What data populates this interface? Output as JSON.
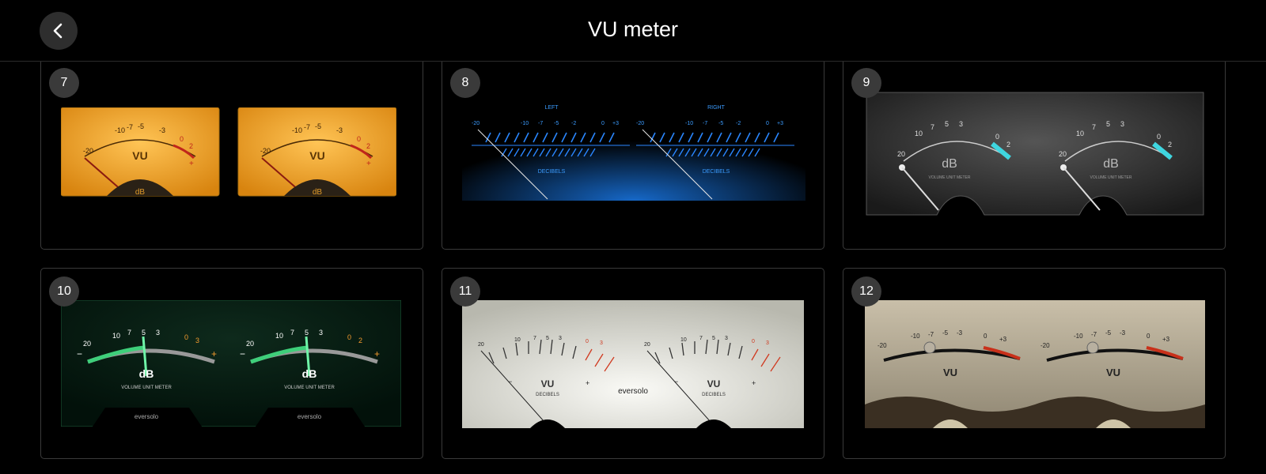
{
  "header": {
    "title": "VU meter"
  },
  "cards": [
    {
      "number": "7",
      "scale": [
        "-20",
        "-10",
        "-7",
        "-5",
        "-3",
        "0",
        "2",
        "+"
      ],
      "label": "VU",
      "sub": "dB"
    },
    {
      "number": "8",
      "left": "LEFT",
      "right": "RIGHT",
      "scale": [
        "-20",
        "-10",
        "-7",
        "-5",
        "-2",
        "0",
        "+3"
      ],
      "sub": "DECIBELS"
    },
    {
      "number": "9",
      "scale": [
        "20",
        "10",
        "7",
        "5",
        "3",
        "0",
        "2"
      ],
      "label": "dB",
      "sub": "VOLUME UNIT METER"
    },
    {
      "number": "10",
      "scale": [
        "20",
        "10",
        "7",
        "5",
        "3",
        "0",
        "3",
        "2"
      ],
      "label": "dB",
      "sub": "VOLUME UNIT METER",
      "brand": "eversolo"
    },
    {
      "number": "11",
      "scale": [
        "20",
        "10",
        "7",
        "5",
        "3",
        "0",
        "3"
      ],
      "label": "VU",
      "sub": "DECIBELS",
      "brand": "eversolo"
    },
    {
      "number": "12",
      "scale": [
        "-20",
        "-10",
        "-7",
        "-5",
        "-3",
        "0",
        "+3"
      ],
      "label": "VU"
    }
  ],
  "colors": {
    "accent_blue": "#1e90ff",
    "amber": "#f2a224",
    "teal": "#3fd6e0",
    "green": "#3ecf7a"
  }
}
